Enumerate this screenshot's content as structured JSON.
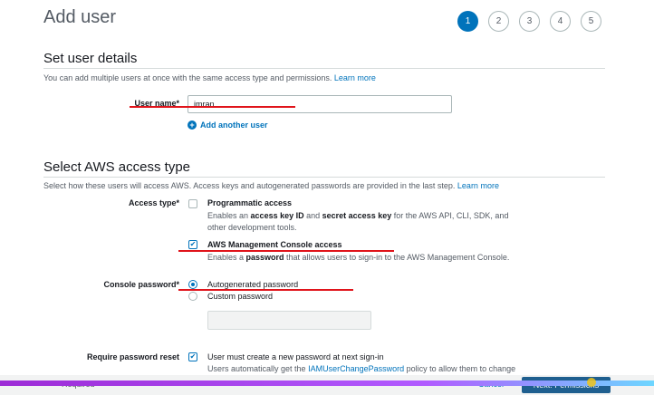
{
  "page": {
    "title": "Add user"
  },
  "steps": [
    "1",
    "2",
    "3",
    "4",
    "5"
  ],
  "details": {
    "title": "Set user details",
    "desc": "You can add multiple users at once with the same access type and permissions.",
    "learn_more": "Learn more",
    "username_label": "User name*",
    "username_value": "imran",
    "add_another": "Add another user"
  },
  "access": {
    "title": "Select AWS access type",
    "desc": "Select how these users will access AWS. Access keys and autogenerated passwords are provided in the last step.",
    "learn_more": "Learn more",
    "type_label": "Access type*",
    "programmatic_title": "Programmatic access",
    "programmatic_desc": {
      "p1": "Enables an ",
      "b1": "access key ID",
      "p2": " and ",
      "b2": "secret access key",
      "p3": " for the AWS API, CLI, SDK, and other development tools."
    },
    "console_title": "AWS Management Console access",
    "console_desc": {
      "p1": "Enables a ",
      "b1": "password",
      "p2": " that allows users to sign-in to the AWS Management Console."
    },
    "console_checked": true,
    "programmatic_checked": false,
    "password_label": "Console password*",
    "autogen": "Autogenerated password",
    "custom": "Custom password",
    "reset_label": "Require password reset",
    "reset_text": "User must create a new password at next sign-in",
    "reset_note_prefix": "Users automatically get the ",
    "reset_note_link": "IAMUserChangePassword",
    "reset_note_suffix": " policy to allow them to change"
  },
  "footer": {
    "required": "* Required",
    "cancel": "Cancel",
    "next": "Next: Permissions"
  },
  "colors": {
    "accent": "#0073bb",
    "annotation": "#e0141b"
  }
}
